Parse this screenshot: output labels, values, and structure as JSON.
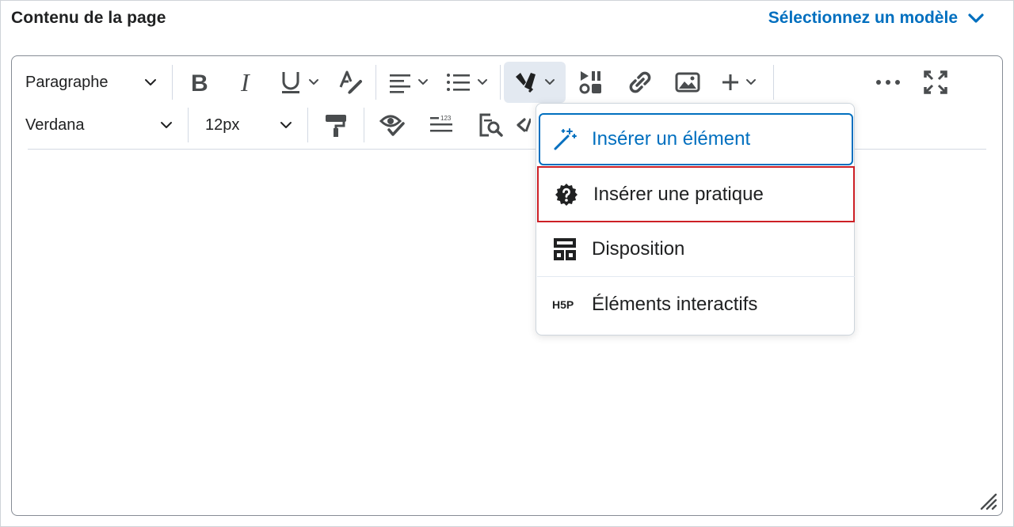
{
  "header": {
    "title": "Contenu de la page",
    "template_link": "Sélectionnez un modèle"
  },
  "toolbar": {
    "block_format": "Paragraphe",
    "font_family": "Verdana",
    "font_size": "12px",
    "row1_icons": [
      "bold-icon",
      "italic-icon",
      "underline-icon",
      "text-color-icon",
      "align-icon",
      "list-icon",
      "insert-stuff-icon",
      "media-icon",
      "link-icon",
      "image-icon",
      "plus-icon",
      "more-icon",
      "fullscreen-icon"
    ],
    "row2_icons": [
      "format-painter-icon",
      "accessibility-checker-icon",
      "word-count-icon",
      "find-replace-icon",
      "source-code-icon"
    ]
  },
  "menu": {
    "items": [
      {
        "label": "Insérer un élément",
        "icon": "magic-wand-icon",
        "state": "focused"
      },
      {
        "label": "Insérer une pratique",
        "icon": "question-badge-icon",
        "state": "highlighted"
      },
      {
        "label": "Disposition",
        "icon": "layout-icon",
        "state": "normal"
      },
      {
        "label": "Éléments interactifs",
        "icon": "h5p-icon",
        "state": "normal"
      }
    ]
  },
  "colors": {
    "accent": "#006fbf",
    "highlight_border": "#cd2026",
    "text": "#202122",
    "active_button_bg": "#e3e9f1"
  }
}
